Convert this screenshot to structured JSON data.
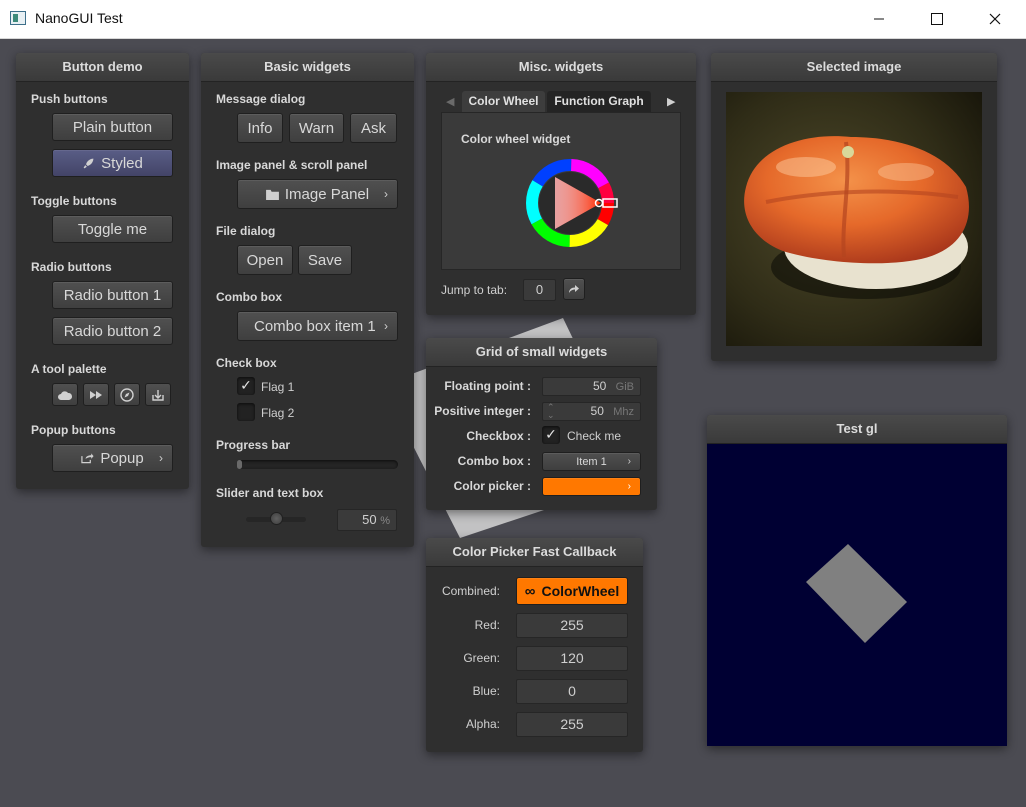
{
  "window": {
    "title": "NanoGUI Test"
  },
  "colors": {
    "accent_orange": "#ff7800",
    "gl_background": "#000033",
    "styled_button": "#4d4f78"
  },
  "button_demo": {
    "title": "Button demo",
    "push_label": "Push buttons",
    "plain": "Plain button",
    "styled": "Styled",
    "toggle_label": "Toggle buttons",
    "toggle": "Toggle me",
    "radio_label": "Radio buttons",
    "radio1": "Radio button 1",
    "radio2": "Radio button 2",
    "palette_label": "A tool palette",
    "palette_icons": [
      "cloud-icon",
      "fast-forward-icon",
      "compass-icon",
      "install-icon"
    ],
    "popup_label": "Popup buttons",
    "popup": "Popup"
  },
  "basic": {
    "title": "Basic widgets",
    "message_label": "Message dialog",
    "info": "Info",
    "warn": "Warn",
    "ask": "Ask",
    "image_label": "Image panel & scroll panel",
    "image_panel": "Image Panel",
    "file_label": "File dialog",
    "open": "Open",
    "save": "Save",
    "combo_label": "Combo box",
    "combo_value": "Combo box item 1",
    "check_label": "Check box",
    "flag1": "Flag 1",
    "flag1_checked": true,
    "flag2": "Flag 2",
    "flag2_checked": false,
    "progress_label": "Progress bar",
    "progress_value": 0.02,
    "slider_label": "Slider and text box",
    "slider_value": 0.5,
    "slider_text": "50",
    "slider_unit": "%"
  },
  "misc": {
    "title": "Misc. widgets",
    "tab1": "Color Wheel",
    "tab2": "Function Graph",
    "wheel_label": "Color wheel widget",
    "jump_label": "Jump to tab:",
    "jump_value": "0"
  },
  "selected_image": {
    "title": "Selected image"
  },
  "grid": {
    "title": "Grid of small widgets",
    "float_label": "Floating point :",
    "float_value": "50",
    "float_unit": "GiB",
    "int_label": "Positive integer :",
    "int_value": "50",
    "int_unit": "Mhz",
    "checkbox_label": "Checkbox :",
    "checkbox_text": "Check me",
    "checkbox_checked": true,
    "combo_label": "Combo box :",
    "combo_value": "Item 1",
    "picker_label": "Color picker :"
  },
  "fast_picker": {
    "title": "Color Picker Fast Callback",
    "combined_label": "Combined:",
    "combined_value": "ColorWheel",
    "red_label": "Red:",
    "red": "255",
    "green_label": "Green:",
    "green": "120",
    "blue_label": "Blue:",
    "blue": "0",
    "alpha_label": "Alpha:",
    "alpha": "255"
  },
  "test_gl": {
    "title": "Test gl"
  }
}
